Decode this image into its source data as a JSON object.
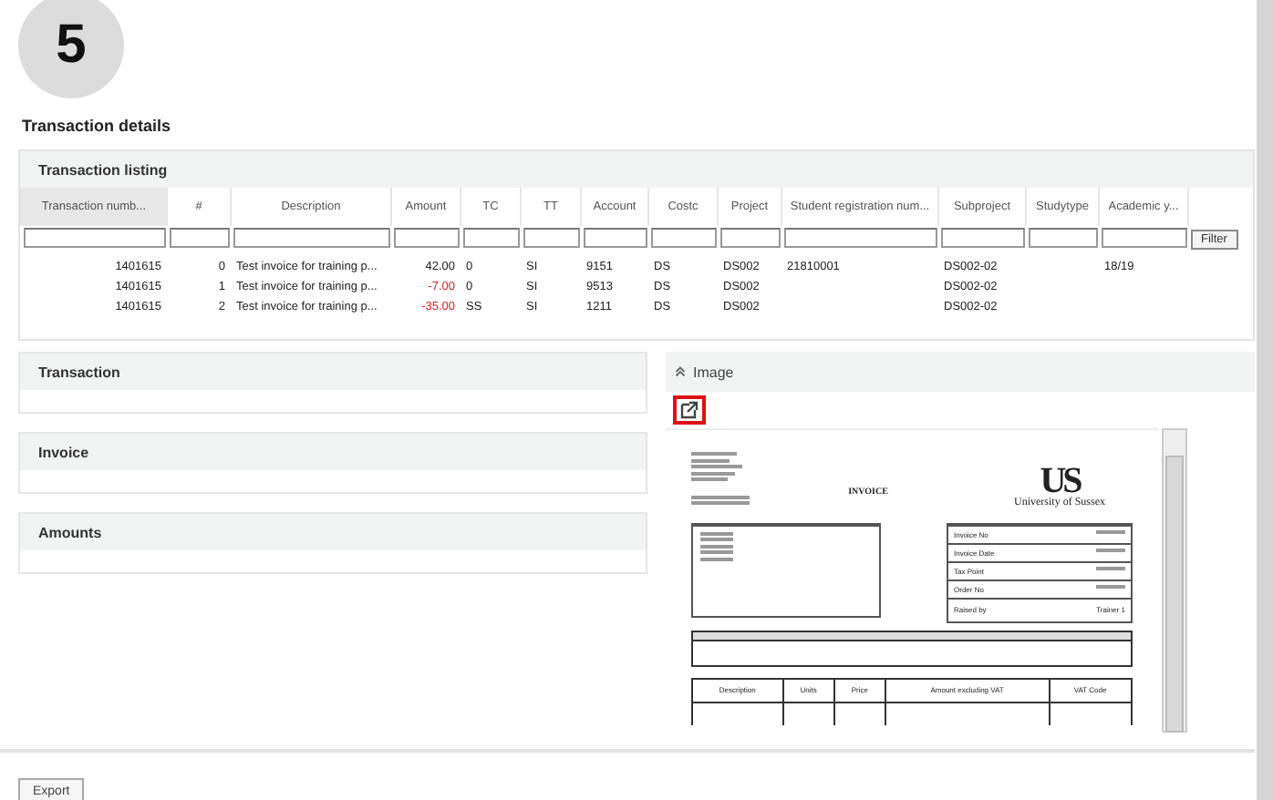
{
  "step_badge": "5",
  "page_title": "Transaction details",
  "listing": {
    "title": "Transaction listing",
    "filter_button": "Filter",
    "columns": [
      "Transaction numb...",
      "#",
      "Description",
      "Amount",
      "TC",
      "TT",
      "Account",
      "Costc",
      "Project",
      "Student registration num...",
      "Subproject",
      "Studytype",
      "Academic y..."
    ],
    "rows": [
      {
        "negative": false,
        "cells": [
          "1401615",
          "0",
          "Test invoice for training p...",
          "42.00",
          "0",
          "SI",
          "9151",
          "DS",
          "DS002",
          "21810001",
          "DS002-02",
          null,
          "18/19"
        ]
      },
      {
        "negative": true,
        "cells": [
          "1401615",
          "1",
          "Test invoice for training p...",
          "-7.00",
          "0",
          "SI",
          "9513",
          "DS",
          "DS002",
          null,
          "DS002-02",
          null,
          null
        ]
      },
      {
        "negative": true,
        "cells": [
          "1401615",
          "2",
          "Test invoice for training p...",
          "-35.00",
          "SS",
          "SI",
          "1211",
          "DS",
          "DS002",
          null,
          "DS002-02",
          null,
          null
        ]
      }
    ]
  },
  "sections": [
    {
      "title": "Transaction"
    },
    {
      "title": "Invoice"
    },
    {
      "title": "Amounts"
    }
  ],
  "image_panel": {
    "title": "Image",
    "expanded": true,
    "document": {
      "heading": "INVOICE",
      "logo": "US",
      "org_name": "University of Sussex",
      "info_rows": [
        {
          "label": "Invoice No"
        },
        {
          "label": "Invoice Date"
        },
        {
          "label": "Tax Point"
        },
        {
          "label": "Order No"
        },
        {
          "label": "Raised by",
          "value": "Trainer 1"
        }
      ],
      "item_columns": [
        "Description",
        "Units",
        "Price",
        "Amount excluding VAT",
        "VAT Code"
      ]
    }
  },
  "export_button": "Export"
}
